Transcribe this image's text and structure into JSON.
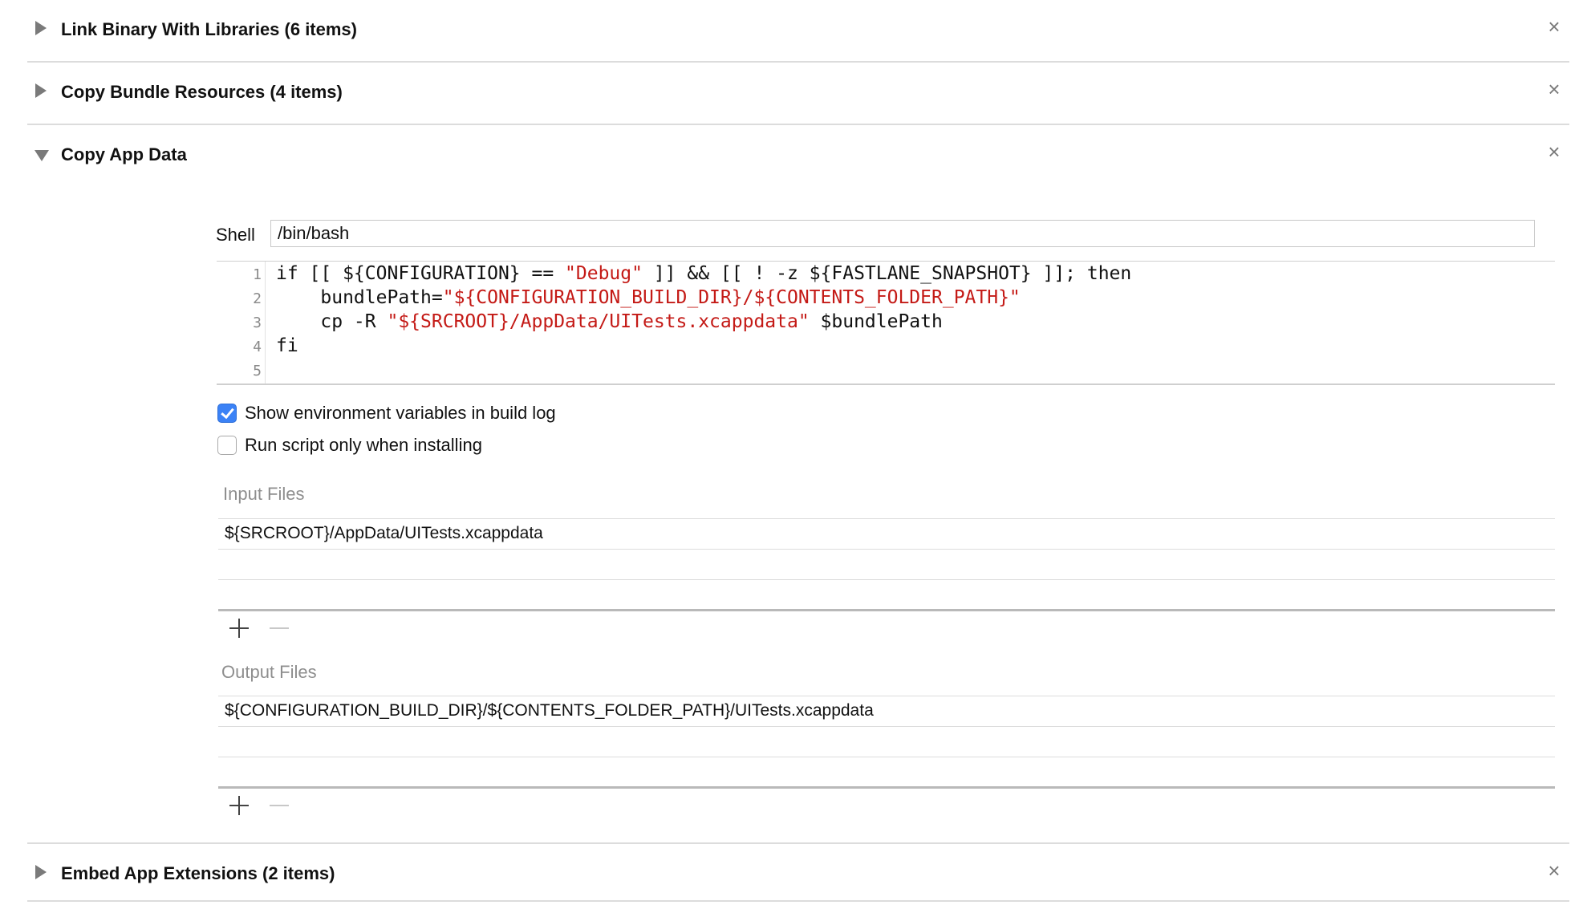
{
  "phases": [
    {
      "title": "Link Binary With Libraries (6 items)",
      "expanded": false,
      "close": "×"
    },
    {
      "title": "Copy Bundle Resources (4 items)",
      "expanded": false,
      "close": "×"
    },
    {
      "title": "Copy App Data",
      "expanded": true,
      "close": "×"
    },
    {
      "title": "Embed App Extensions (2 items)",
      "expanded": false,
      "close": "×"
    }
  ],
  "run_script": {
    "shell_label": "Shell",
    "shell_value": "/bin/bash",
    "code": {
      "line_numbers": [
        "1",
        "2",
        "3",
        "4",
        "5"
      ],
      "l1_a": "if [[ ${CONFIGURATION} == ",
      "l1_s": "\"Debug\"",
      "l1_b": " ]] && [[ ! -z ${FASTLANE_SNAPSHOT} ]]; then",
      "l2_a": "    bundlePath=",
      "l2_s": "\"${CONFIGURATION_BUILD_DIR}/${CONTENTS_FOLDER_PATH}\"",
      "l3_a": "    cp -R ",
      "l3_s": "\"${SRCROOT}/AppData/UITests.xcappdata\"",
      "l3_b": " $bundlePath",
      "l4": "fi",
      "l5": ""
    },
    "options": [
      {
        "label": "Show environment variables in build log",
        "checked": true
      },
      {
        "label": "Run script only when installing",
        "checked": false
      }
    ],
    "input_files": {
      "label": "Input Files",
      "items": [
        "${SRCROOT}/AppData/UITests.xcappdata"
      ]
    },
    "output_files": {
      "label": "Output Files",
      "items": [
        "${CONFIGURATION_BUILD_DIR}/${CONTENTS_FOLDER_PATH}/UITests.xcappdata"
      ]
    }
  },
  "colors": {
    "string": "#c41a16",
    "checkbox_on": "#3b82f6",
    "disclosure": "#7a7a7a"
  },
  "icons": {
    "add": "plus-icon",
    "remove": "minus-icon",
    "close": "close-icon"
  }
}
